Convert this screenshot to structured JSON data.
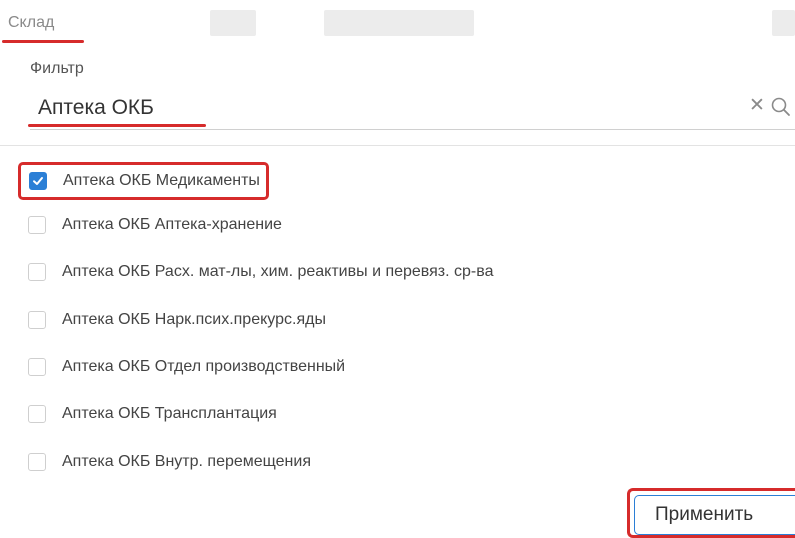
{
  "header": {
    "tab_label": "Склад"
  },
  "filter": {
    "label": "Фильтр",
    "value": "Аптека ОКБ",
    "clear_symbol": "✕"
  },
  "options": [
    {
      "label": "Аптека ОКБ Медикаменты",
      "checked": true
    },
    {
      "label": "Аптека ОКБ Аптека-хранение",
      "checked": false
    },
    {
      "label": "Аптека ОКБ Расх. мат-лы, хим. реактивы и перевяз. ср-ва",
      "checked": false
    },
    {
      "label": "Аптека ОКБ Нарк.псих.прекурс.яды",
      "checked": false
    },
    {
      "label": "Аптека ОКБ Отдел производственный",
      "checked": false
    },
    {
      "label": "Аптека ОКБ Трансплантация",
      "checked": false
    },
    {
      "label": "Аптека ОКБ Внутр. перемещения",
      "checked": false
    }
  ],
  "actions": {
    "apply_label": "Применить"
  },
  "colors": {
    "accent": "#2b7fd6",
    "highlight": "#d62b2b"
  }
}
